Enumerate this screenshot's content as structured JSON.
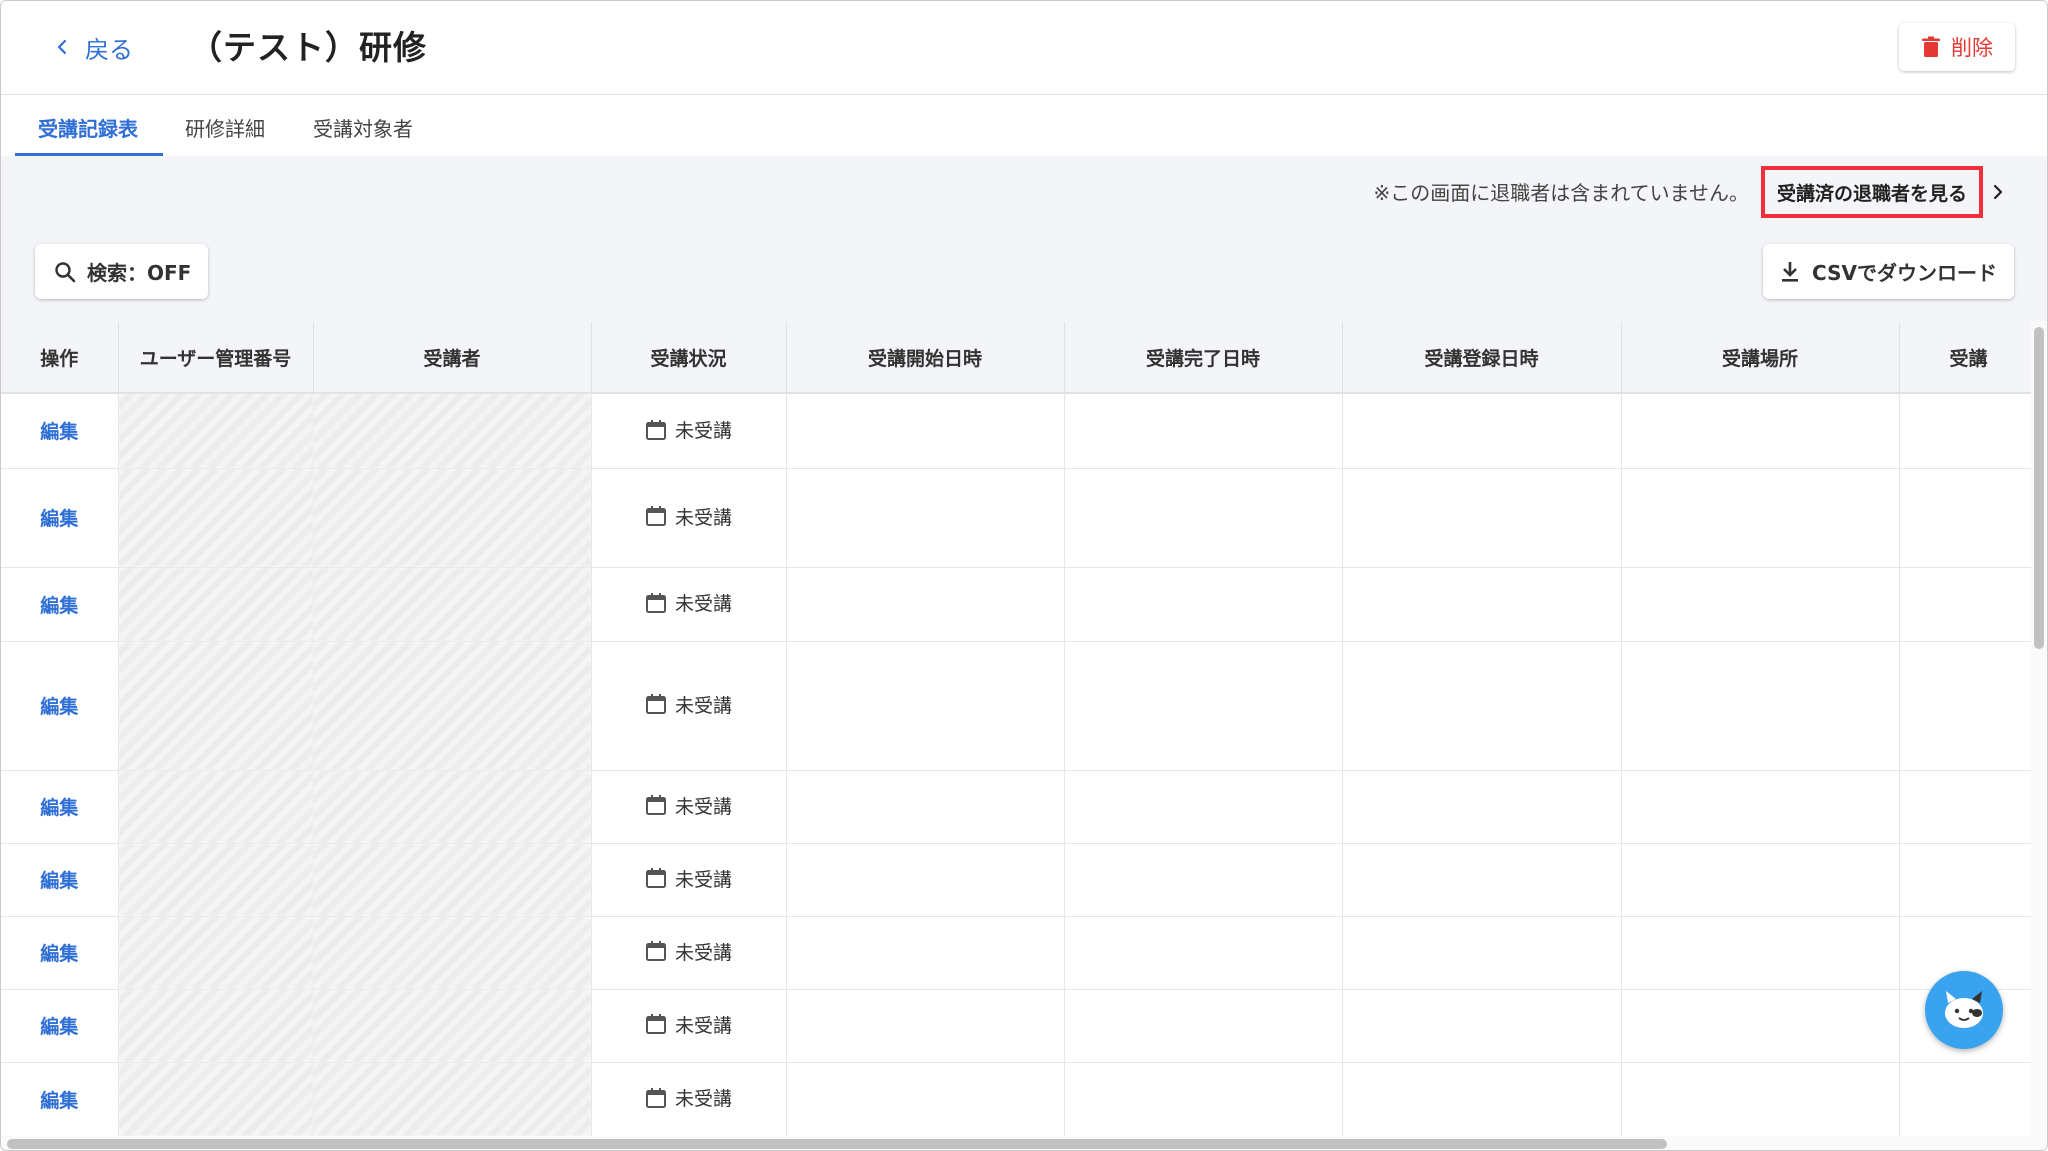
{
  "header": {
    "back_label": "戻る",
    "title": "（テスト）研修",
    "delete_label": "削除"
  },
  "tabs": [
    {
      "label": "受講記録表",
      "active": true
    },
    {
      "label": "研修詳細",
      "active": false
    },
    {
      "label": "受講対象者",
      "active": false
    }
  ],
  "toolbar": {
    "notice": "※この画面に退職者は含まれていません。",
    "retired_link": "受講済の退職者を見る",
    "search_label": "検索：OFF",
    "csv_label": "CSVでダウンロード"
  },
  "table": {
    "columns": [
      "操作",
      "ユーザー管理番号",
      "受講者",
      "受講状況",
      "受講開始日時",
      "受講完了日時",
      "受講登録日時",
      "受講場所",
      "受講"
    ],
    "rows": [
      {
        "action": "編集",
        "status": "未受講"
      },
      {
        "action": "編集",
        "status": "未受講"
      },
      {
        "action": "編集",
        "status": "未受講"
      },
      {
        "action": "編集",
        "status": "未受講"
      },
      {
        "action": "編集",
        "status": "未受講"
      },
      {
        "action": "編集",
        "status": "未受講"
      },
      {
        "action": "編集",
        "status": "未受講"
      },
      {
        "action": "編集",
        "status": "未受講"
      },
      {
        "action": "編集",
        "status": "未受講"
      }
    ]
  },
  "colors": {
    "accent": "#2f6fd6",
    "danger": "#e53935",
    "highlight": "#ef2f3a",
    "chat": "#3aa3f0"
  },
  "icons": [
    "chevron-left-icon",
    "trash-icon",
    "chevron-right-icon",
    "search-icon",
    "download-icon",
    "calendar-icon",
    "chatbot-icon"
  ]
}
